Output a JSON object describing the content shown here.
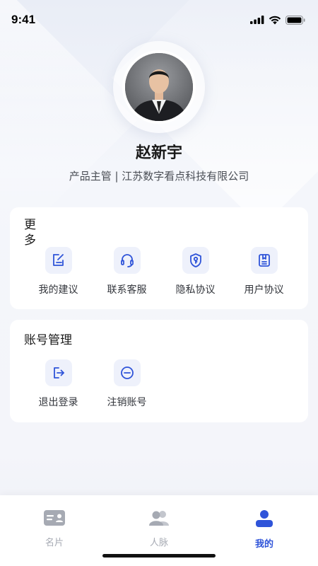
{
  "status_bar": {
    "time": "9:41"
  },
  "profile": {
    "name": "赵新宇",
    "description": "产品主管 | 江苏数字看点科技有限公司"
  },
  "more_section": {
    "title": "更多",
    "items": [
      {
        "label": "我的建议",
        "icon": "edit-note-icon"
      },
      {
        "label": "联系客服",
        "icon": "headset-icon"
      },
      {
        "label": "隐私协议",
        "icon": "shield-key-icon"
      },
      {
        "label": "用户协议",
        "icon": "bookmark-doc-icon"
      }
    ]
  },
  "account_section": {
    "title": "账号管理",
    "items": [
      {
        "label": "退出登录",
        "icon": "logout-icon"
      },
      {
        "label": "注销账号",
        "icon": "minus-circle-icon"
      }
    ]
  },
  "tabbar": {
    "tabs": [
      {
        "label": "名片",
        "icon": "business-card-icon",
        "active": false
      },
      {
        "label": "人脉",
        "icon": "contacts-icon",
        "active": false
      },
      {
        "label": "我的",
        "icon": "person-icon",
        "active": true
      }
    ]
  },
  "colors": {
    "accent": "#2f54d9",
    "icon_bg": "#eef1fb",
    "inactive": "#a6aab3"
  }
}
